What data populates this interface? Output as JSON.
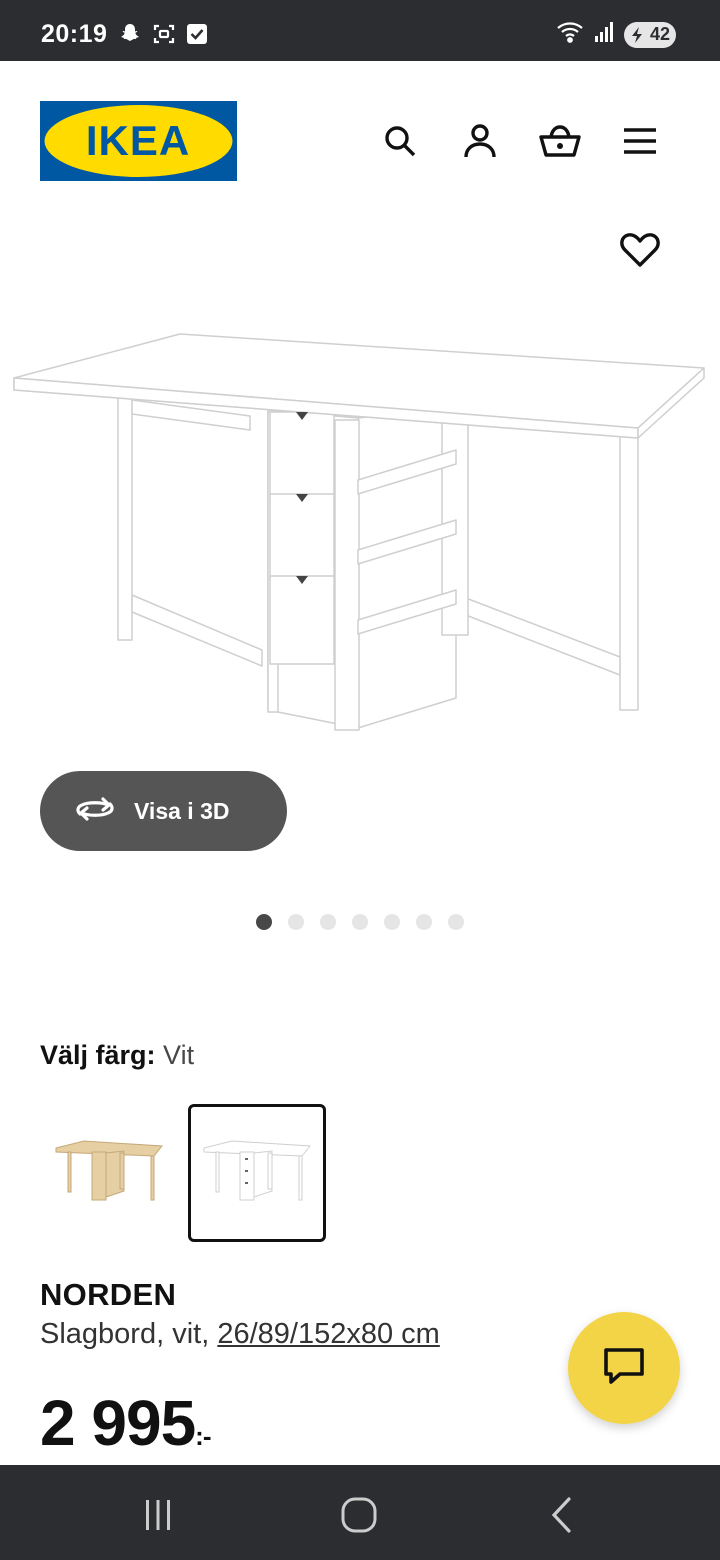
{
  "status_bar": {
    "time": "20:19",
    "battery": "42",
    "icons": [
      "snapchat-icon",
      "screenshot-icon",
      "check-icon",
      "wifi-icon",
      "signal-icon",
      "battery-icon"
    ]
  },
  "header": {
    "logo_text": "IKEA",
    "icons": [
      "search-icon",
      "account-icon",
      "basket-icon",
      "menu-icon"
    ]
  },
  "gallery": {
    "view_3d_label": "Visa i 3D",
    "dots_total": 7,
    "active_dot": 1
  },
  "color_picker": {
    "label": "Välj färg:",
    "selected_value": "Vit",
    "options": [
      {
        "name": "Björk",
        "selected": false
      },
      {
        "name": "Vit",
        "selected": true
      }
    ]
  },
  "product": {
    "name": "NORDEN",
    "description": "Slagbord, vit, ",
    "measurements": "26/89/152x80 cm",
    "price": "2 995",
    "price_suffix": ":-"
  },
  "colors": {
    "status_bar_bg": "#2b2d31",
    "ikea_blue": "#0058a3",
    "ikea_yellow": "#ffdb00",
    "chat_fab": "#f3d447",
    "button_3d_bg": "#555555"
  }
}
